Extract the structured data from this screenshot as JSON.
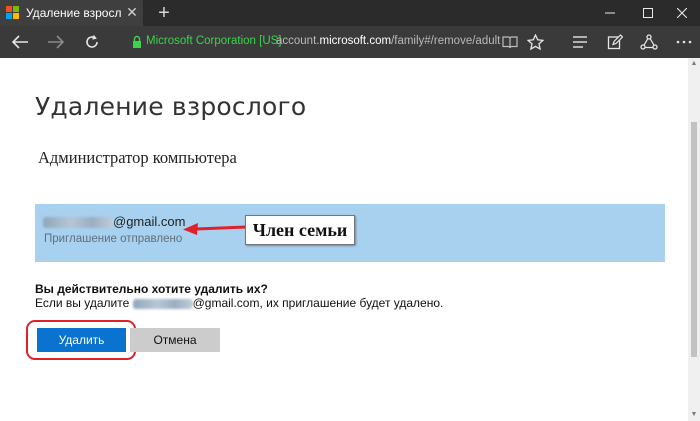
{
  "browser": {
    "tab_title": "Удаление взрослого",
    "tab_close": "✕",
    "new_tab": "+",
    "window_controls": {
      "minimize": "—",
      "maximize": "☐",
      "close": "✕"
    },
    "address": {
      "certificate": "Microsoft Corporation [US]",
      "url_prefix": "account.",
      "url_domain": "microsoft.com",
      "url_path": "/family#/remove/adult"
    },
    "favicon_colors": [
      "#f25022",
      "#7fba00",
      "#00a4ef",
      "#ffb900"
    ],
    "icons": [
      "back-icon",
      "forward-icon",
      "refresh-icon",
      "lock-icon",
      "reading-view-icon",
      "favorite-star-icon",
      "hub-icon",
      "web-note-icon",
      "share-icon"
    ]
  },
  "page": {
    "title": "Удаление взрослого",
    "role": "Администратор компьютера",
    "member": {
      "email_suffix": "@gmail.com",
      "status": "Приглашение отправлено"
    },
    "annotation": "Член семьи",
    "question": "Вы действительно хотите удалить их?",
    "warning_prefix": "Если вы удалите ",
    "warning_suffix": "@gmail.com, их приглашение будет удалено.",
    "buttons": {
      "delete": "Удалить",
      "cancel": "Отмена"
    }
  },
  "colors": {
    "accent": "#0a72cf",
    "member_box": "#a8d1f0",
    "annotation_red": "#e0202a",
    "certificate_green": "#3bd44b"
  }
}
